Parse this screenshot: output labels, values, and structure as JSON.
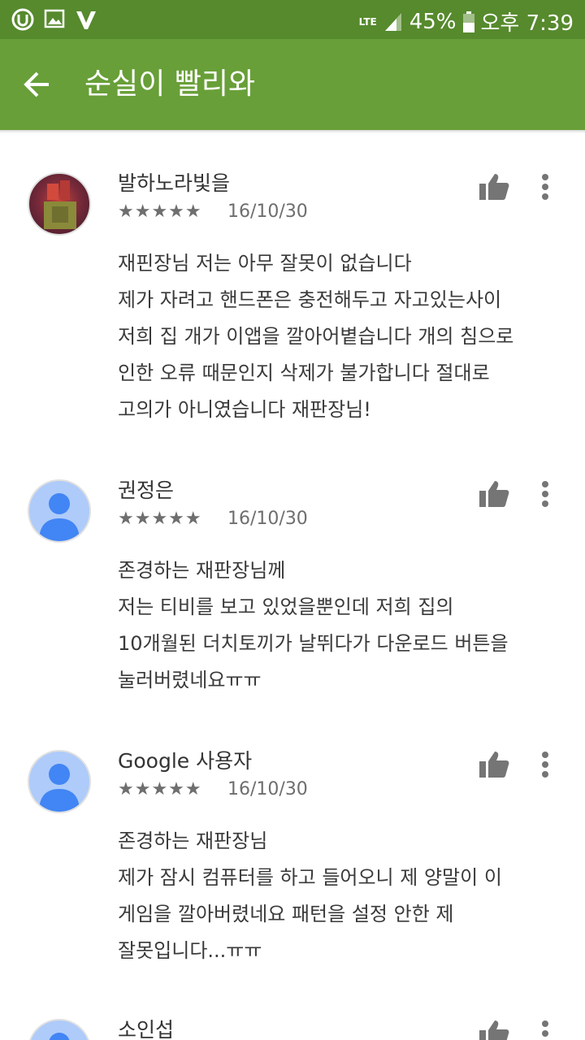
{
  "status_bar": {
    "network": "LTE",
    "battery": "45%",
    "time": "오후 7:39"
  },
  "app_bar": {
    "title": "순실이 빨리와"
  },
  "reviews": [
    {
      "author": "발하노라빛을",
      "stars": "★★★★★",
      "date": "16/10/30",
      "text": "재핀장님 저는 아무 잘못이 없습니다\n제가 자려고 핸드폰은 충전해두고 자고있는사이\n저희 집 개가 이앱을 깔아어볕습니다 개의 침으로\n인한 오류 때문인지 삭제가 불가합니다 절대로\n고의가 아니였습니다 재판장님!"
    },
    {
      "author": "권정은",
      "stars": "★★★★★",
      "date": "16/10/30",
      "text": "존경하는 재판장님께\n저는 티비를 보고 있었을뿐인데 저희 집의\n10개월된 더치토끼가 날뛰다가 다운로드 버튼을\n눌러버렸네요ㅠㅠ"
    },
    {
      "author": "Google 사용자",
      "stars": "★★★★★",
      "date": "16/10/30",
      "text": "존경하는 재판장님\n제가 잠시 컴퓨터를 하고 들어오니 제 양말이 이\n게임을 깔아버렸네요 패턴을 설정 안한 제\n잘못입니다...ㅠㅠ"
    },
    {
      "author": "소인섭",
      "stars": "",
      "date": "",
      "text": ""
    }
  ]
}
